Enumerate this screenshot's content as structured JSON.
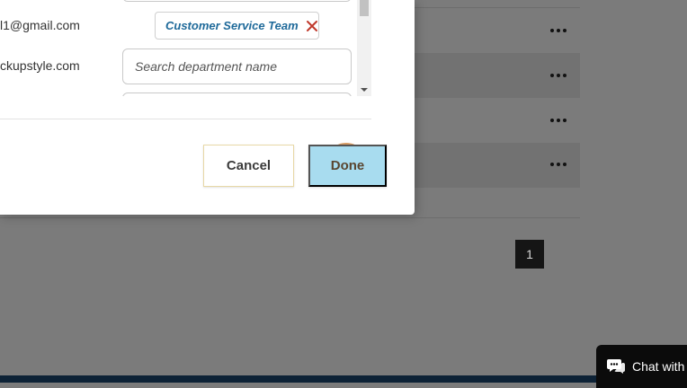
{
  "modal": {
    "members": [
      {
        "email": "l1@gmail.com",
        "department_chip": "Customer Service Team"
      },
      {
        "email": "ckupstyle.com"
      }
    ],
    "search": {
      "placeholder": "Search department name",
      "value": ""
    },
    "buttons": {
      "cancel_label": "Cancel",
      "done_label": "Done"
    }
  },
  "background": {
    "row_menu_icon": "more-horizontal-icon",
    "pagination": {
      "current_page": "1"
    }
  },
  "chat_widget": {
    "label": "Chat with",
    "icon": "chat-bubble-icon"
  },
  "colors": {
    "chip_text": "#1f6a9a",
    "chip_remove": "#c0392b",
    "done_button": "#a8dcef",
    "chat_widget": "#0b0b0b",
    "footer_bar": "#0d2236"
  }
}
